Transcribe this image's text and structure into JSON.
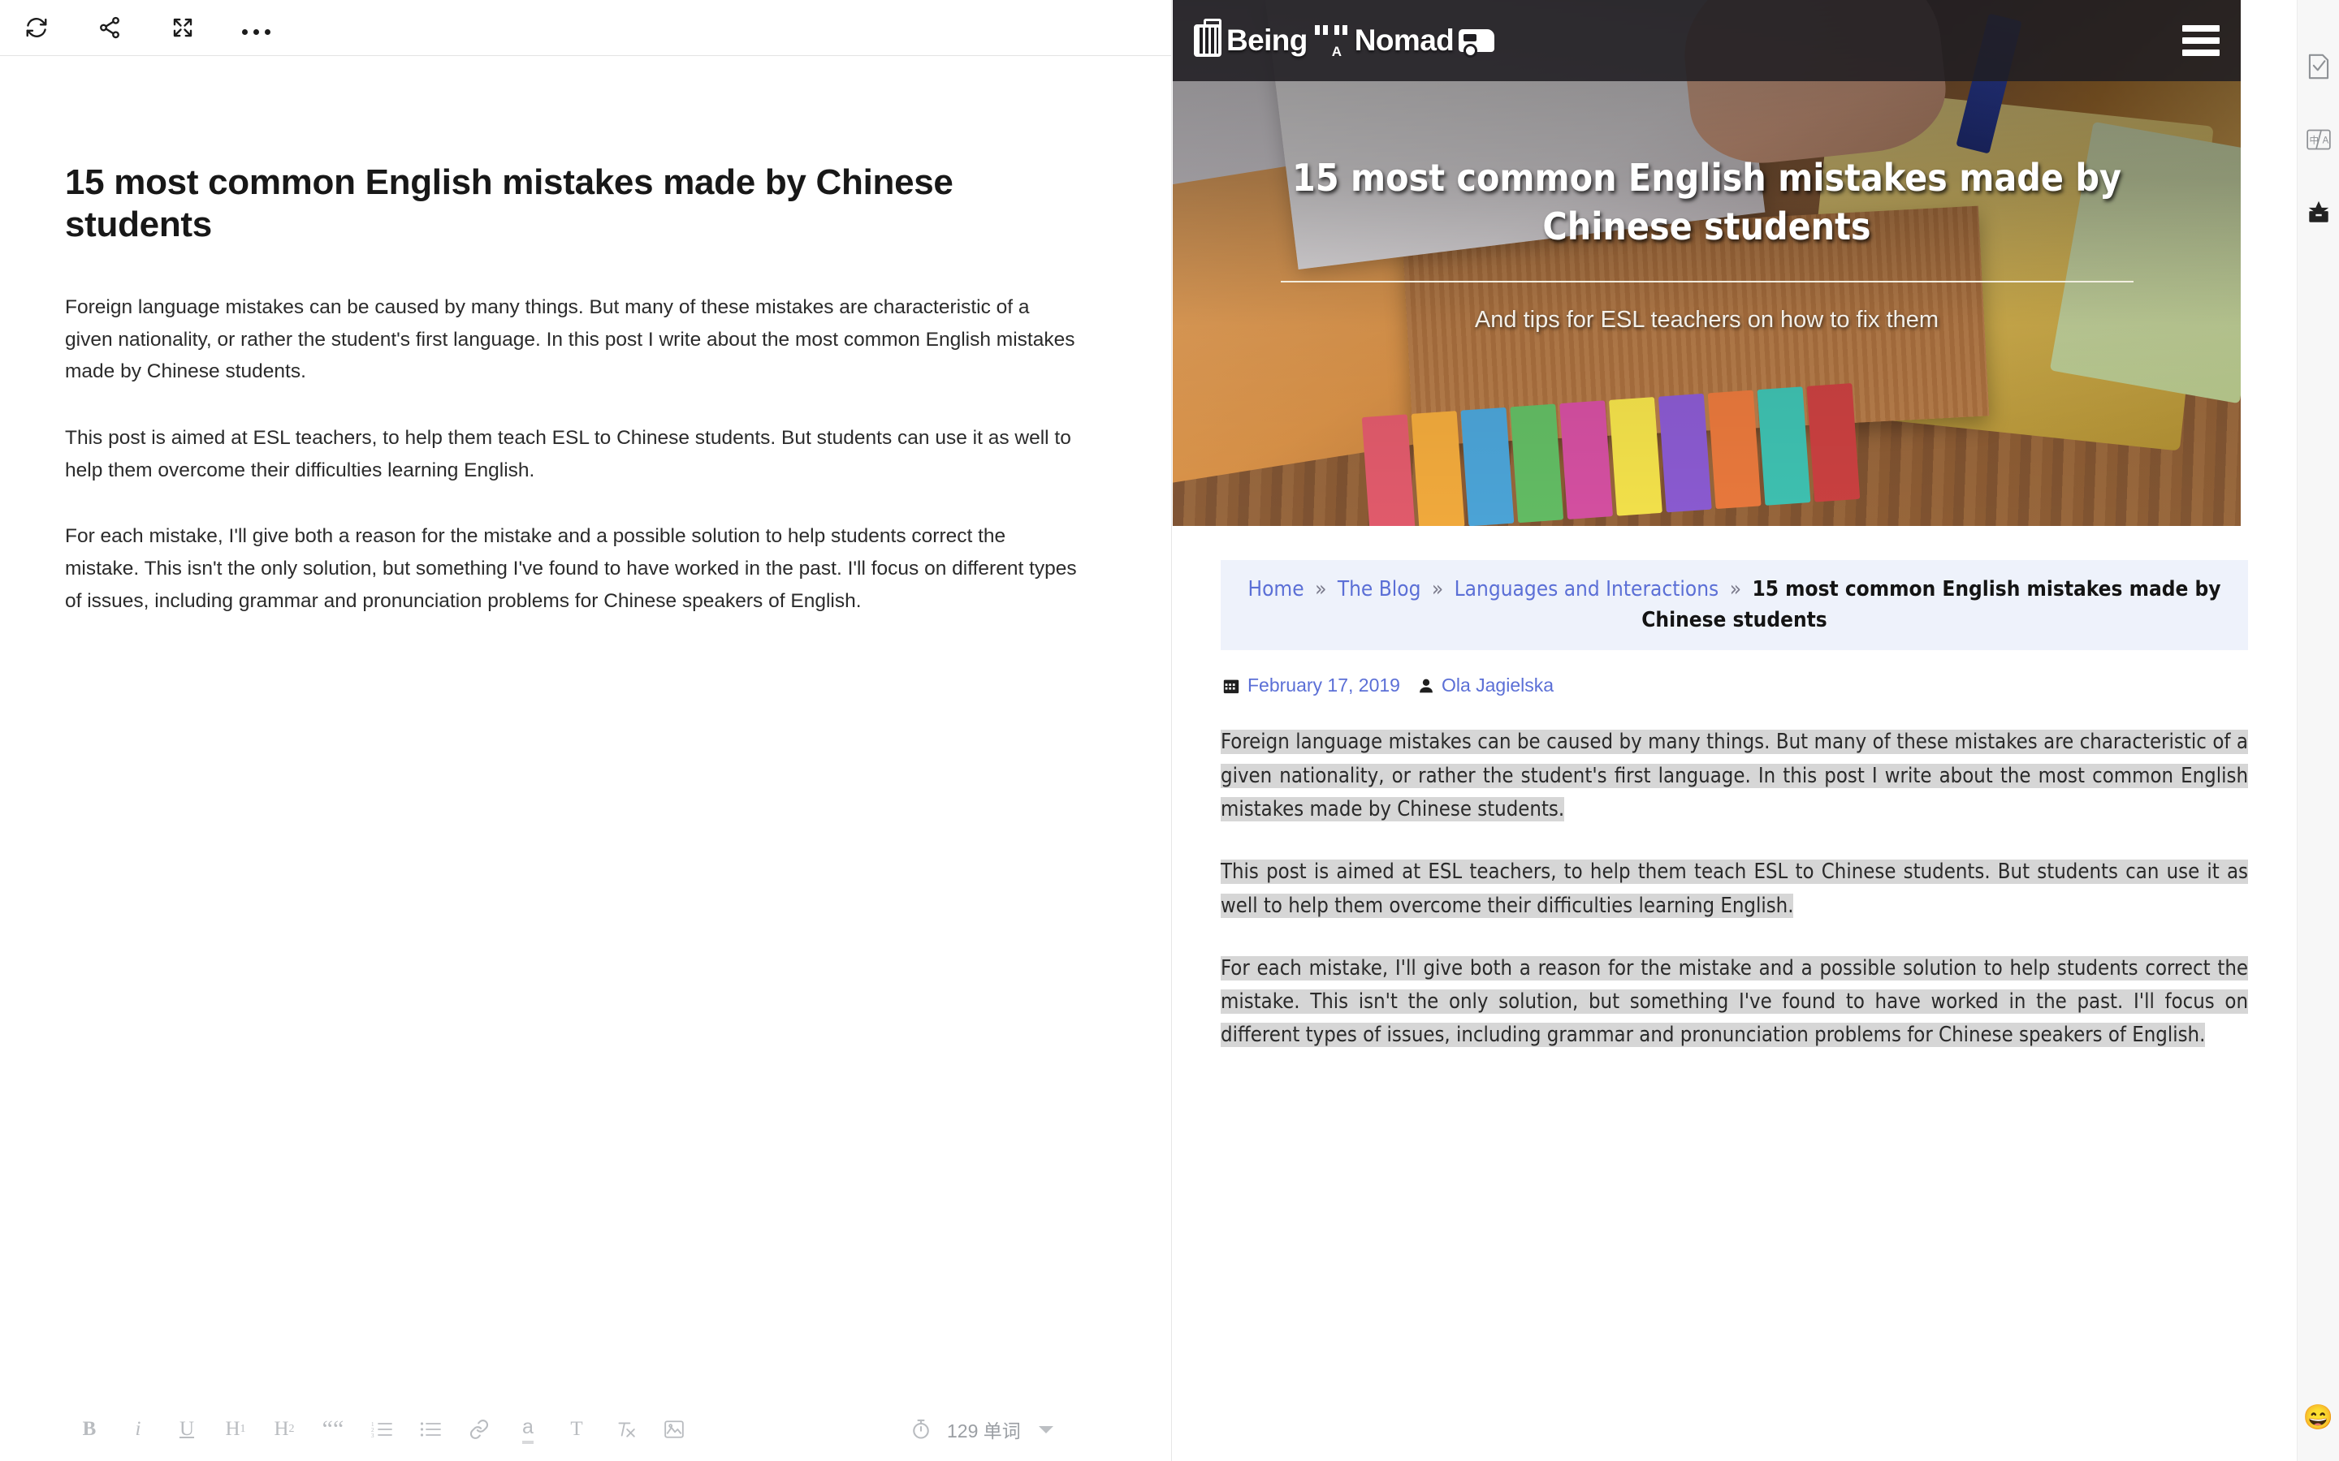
{
  "editor": {
    "toolbar": [
      {
        "name": "refresh-icon",
        "label": "Refresh"
      },
      {
        "name": "share-icon",
        "label": "Share"
      },
      {
        "name": "fullscreen-icon",
        "label": "Fullscreen"
      },
      {
        "name": "more-options-icon",
        "label": "More"
      }
    ],
    "title": "15 most common English mistakes made by Chinese students",
    "paragraphs": [
      "Foreign language mistakes can be caused by many things. But many of these mistakes are characteristic of a given nationality, or rather the student's first language. In this post I write about the most common English mistakes made by Chinese students.",
      "This post is aimed at ESL teachers, to help them teach ESL to Chinese students. But students can use it as well to help them overcome their difficulties learning English.",
      "For each mistake, I'll give both a reason for the mistake and a possible solution to help students correct the mistake. This isn't the only solution, but something I've found to have worked in the past. I'll focus on different types of issues, including grammar and pronunciation problems for Chinese speakers of English."
    ],
    "format_tools": [
      {
        "name": "bold-button",
        "label": "B"
      },
      {
        "name": "italic-button",
        "label": "i"
      },
      {
        "name": "underline-button",
        "label": "U"
      },
      {
        "name": "heading-1-button",
        "label": "H",
        "sub": "1"
      },
      {
        "name": "heading-2-button",
        "label": "H",
        "sub": "2"
      },
      {
        "name": "blockquote-button",
        "label": "““"
      },
      {
        "name": "ordered-list-button",
        "label": "list-ordered-icon"
      },
      {
        "name": "unordered-list-button",
        "label": "list-unordered-icon"
      },
      {
        "name": "link-button",
        "label": "link-icon"
      },
      {
        "name": "highlight-button",
        "label": "a"
      },
      {
        "name": "text-color-button",
        "label": "T"
      },
      {
        "name": "clear-format-button",
        "label": "clear-format-icon"
      },
      {
        "name": "insert-image-button",
        "label": "image-icon"
      }
    ],
    "word_count": "129 单词",
    "timer_icon": "stopwatch-icon"
  },
  "preview": {
    "site_logo": {
      "text_before": "Being",
      "letter_a": "A",
      "text_after": "Nomad"
    },
    "menu_icon": "hamburger-menu-icon",
    "hero": {
      "title": "15 most common English mistakes made by Chinese students",
      "subtitle": "And tips for ESL teachers on how to fix them"
    },
    "breadcrumb": {
      "items": [
        {
          "label": "Home",
          "link": true
        },
        {
          "label": "The Blog",
          "link": true
        },
        {
          "label": "Languages and Interactions",
          "link": true
        }
      ],
      "separator": "»",
      "current": "15 most common English mistakes made by Chinese students"
    },
    "meta": {
      "date_icon": "calendar-icon",
      "date": "February 17, 2019",
      "author_icon": "user-icon",
      "author": "Ola Jagielska"
    },
    "paragraphs": [
      "Foreign language mistakes can be caused by many things. But many of these mistakes are characteristic of a given nationality, or rather the student's first language. In this post I write about the most common English mistakes made by Chinese students.",
      "This post is aimed at ESL teachers, to help them teach ESL to Chinese students. But students can use it as well to help them overcome their difficulties learning English.",
      "For each mistake, I'll give both a reason for the mistake and a possible solution to help students correct the mistake. This isn't the only solution, but something I've found to have worked in the past. I'll focus on different types of issues, including grammar and pronunciation problems for Chinese speakers of English."
    ]
  },
  "right_rail": {
    "items": [
      {
        "name": "proofread-icon",
        "label": "Proofread"
      },
      {
        "name": "translate-icon",
        "label": "中/A"
      },
      {
        "name": "collect-box-icon",
        "label": "Collect"
      }
    ],
    "emoji": "😄"
  },
  "colors": {
    "accent_link": "#5b6fd6",
    "breadcrumb_bg": "#eef2fb",
    "selection": "#d6d6d6",
    "header_bg": "#201e22",
    "rail_bg": "#f7f7f7"
  }
}
